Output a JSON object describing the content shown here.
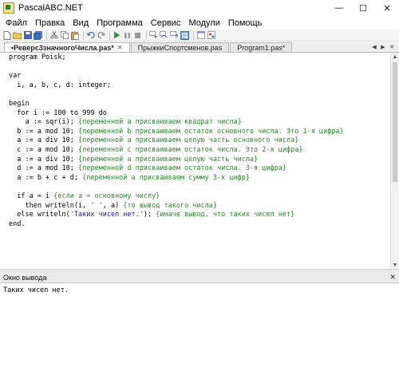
{
  "window": {
    "title": "PascalABC.NET",
    "controls": {
      "minimize": "—",
      "maximize": "☐",
      "close": "✕"
    }
  },
  "menu": {
    "items": [
      "Файл",
      "Правка",
      "Вид",
      "Программа",
      "Сервис",
      "Модули",
      "Помощь"
    ]
  },
  "toolbar": {
    "icons": [
      "new-file-icon",
      "open-folder-icon",
      "save-icon",
      "save-all-icon",
      "cut-icon",
      "copy-icon",
      "paste-icon",
      "undo-icon",
      "redo-icon",
      "run-icon",
      "pause-icon",
      "stop-icon",
      "step-into-icon",
      "step-over-icon",
      "step-out-icon",
      "output-window-icon",
      "debug-window-icon",
      "form-designer-icon"
    ]
  },
  "tabs": [
    {
      "label": "•Реверс3значногоЧисла.pas*",
      "active": true
    },
    {
      "label": "ПрыжкиСпортсменов.pas",
      "active": false
    },
    {
      "label": "Program1.pas*",
      "active": false
    }
  ],
  "editor": {
    "lines": [
      "program Poisk;",
      "",
      "var",
      "  i, a, b, c, d: integer;",
      "",
      "begin",
      "  for i := 100 to 999 do",
      "    a := sqr(i); {переменной a присваиваем квадрат числа}",
      "  b := a mod 10; {переменной b присваиваем остаток основного числа. Это 1-я цифра}",
      "  a := a div 10; {переменной a присваиваем целую часть основного числа}",
      "  c := a mod 10; {переменной c присваиваем остаток числа. Это 2-я цифра}",
      "  a := a div 10; {переменной a присваиваем целую часть числа}",
      "  d := a mod 10; {переменной d присваиваем остаток числа. 3-я цифра}",
      "  a := b + c + d; {переменной a присваиваем сумму 3-х цифр}",
      "",
      "  if a = i {если a = основному числу}",
      "    then writeln(i, ' ', a) {то вывод такого числа}",
      "  else writeln('Таких чисел нет.'); {иначе вывод, что таких чисел нет}",
      "end."
    ]
  },
  "output_panel": {
    "title": "Окно вывода",
    "close": "✕",
    "text": "Таких чисел нет."
  }
}
